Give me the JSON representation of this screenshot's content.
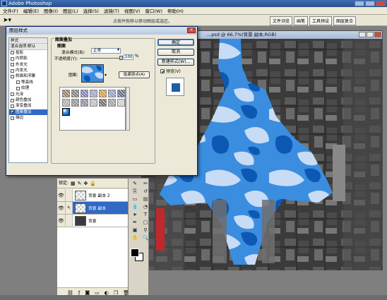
{
  "app": {
    "title": "Adobe Photoshop"
  },
  "menu": [
    "文件(F)",
    "编辑(E)",
    "图像(I)",
    "图层(L)",
    "选择(S)",
    "滤镜(T)",
    "视图(V)",
    "窗口(W)",
    "帮助(H)"
  ],
  "options_bar": {
    "tip": "点按并拖移以移动图层或选区。",
    "tabs": [
      "文件浏览",
      "画笔",
      "工具预设",
      "图层复合"
    ]
  },
  "document": {
    "title": "...psd @ 66.7%(背景 副本,RGB)"
  },
  "dialog": {
    "title": "图层样式",
    "style_list": [
      {
        "label": "样式",
        "type": "header"
      },
      {
        "label": "混合选项:默认",
        "type": "header"
      },
      {
        "label": "投影",
        "checked": false
      },
      {
        "label": "内阴影",
        "checked": false
      },
      {
        "label": "外发光",
        "checked": false
      },
      {
        "label": "内发光",
        "checked": false
      },
      {
        "label": "斜面和浮雕",
        "checked": false
      },
      {
        "label": "等高线",
        "checked": false,
        "sub": true
      },
      {
        "label": "纹理",
        "checked": false,
        "sub": true
      },
      {
        "label": "光泽",
        "checked": false
      },
      {
        "label": "颜色叠加",
        "checked": false
      },
      {
        "label": "渐变叠加",
        "checked": false
      },
      {
        "label": "图案叠加",
        "checked": true,
        "selected": true
      },
      {
        "label": "描边",
        "checked": false
      }
    ],
    "group_title": "图案叠加",
    "group_subtitle": "图案",
    "blend_mode_label": "混合模式(B):",
    "blend_mode_value": "正常",
    "opacity_label": "不透明度(Y):",
    "opacity_value": "100",
    "opacity_unit": "%",
    "opacity_fraction": 1.0,
    "pattern_label": "图案:",
    "snap_button": "贴紧原点(A)",
    "ok_button": "确定",
    "cancel_button": "取消",
    "new_style_button": "新建样式(W)...",
    "preview_label": "预览(V)",
    "preview_checked": true,
    "preview_color": "#1c5fa8"
  },
  "layers": {
    "lock_label": "锁定:",
    "rows": [
      {
        "name": "背景 副本 2",
        "selected": false
      },
      {
        "name": "背景 副本",
        "selected": true
      },
      {
        "name": "背景",
        "selected": false
      }
    ]
  },
  "colors": {
    "accent": "#316ac5",
    "camo_light": "#c8dcf5",
    "camo_mid": "#3b8de0",
    "camo_dark": "#0c58b3"
  }
}
